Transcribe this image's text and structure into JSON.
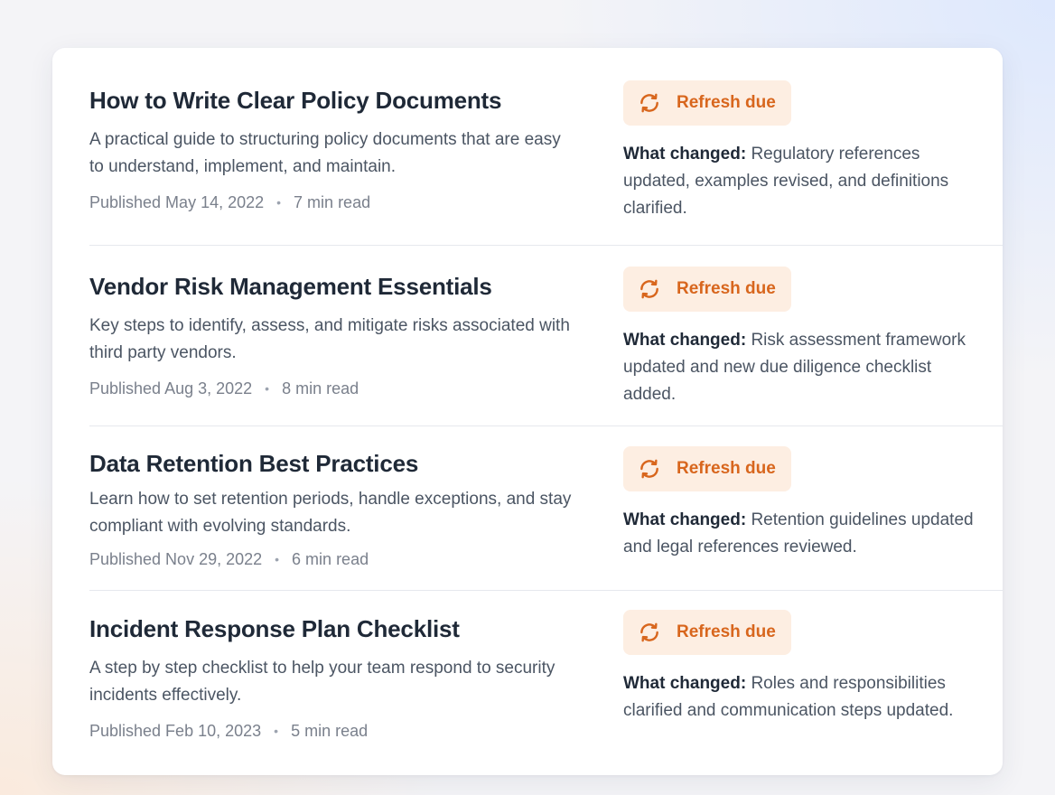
{
  "colors": {
    "accent": "#d8661d",
    "badge_background": "#fdeee2",
    "title_text": "#1f2937",
    "body_text": "#4b5563",
    "meta_text": "#7a808c"
  },
  "articles": [
    {
      "title": "How to Write Clear Policy Documents",
      "description": "A practical guide to structuring policy documents that are easy to understand, implement, and maintain.",
      "published": "Published May 14, 2022",
      "separator": "•",
      "read_time": "7 min read",
      "badge": {
        "label": "Refresh due",
        "icon": "refresh-icon"
      },
      "changed_label": "What changed:",
      "changed_text": " Regulatory references updated, examples revised, and definitions clarified."
    },
    {
      "title": "Vendor Risk Management Essentials",
      "description": "Key steps to identify, assess, and mitigate risks associated with third party vendors.",
      "published": "Published Aug 3, 2022",
      "separator": "•",
      "read_time": "8 min read",
      "badge": {
        "label": "Refresh due",
        "icon": "refresh-icon"
      },
      "changed_label": "What changed:",
      "changed_text": " Risk assessment framework updated and new due diligence checklist added."
    },
    {
      "title": "Data Retention Best Practices",
      "description": "Learn how to set retention periods, handle exceptions, and stay compliant with evolving standards.",
      "published": "Published Nov 29, 2022",
      "separator": "•",
      "read_time": "6 min read",
      "badge": {
        "label": "Refresh due",
        "icon": "refresh-icon"
      },
      "changed_label": "What changed:",
      "changed_text": " Retention guidelines updated and legal references reviewed."
    },
    {
      "title": "Incident Response Plan Checklist",
      "description": "A step by step checklist to help your team respond to security incidents effectively.",
      "published": "Published Feb 10, 2023",
      "separator": "•",
      "read_time": "5 min read",
      "badge": {
        "label": "Refresh due",
        "icon": "refresh-icon"
      },
      "changed_label": "What changed:",
      "changed_text": " Roles and responsibilities clarified and communication steps updated."
    }
  ]
}
